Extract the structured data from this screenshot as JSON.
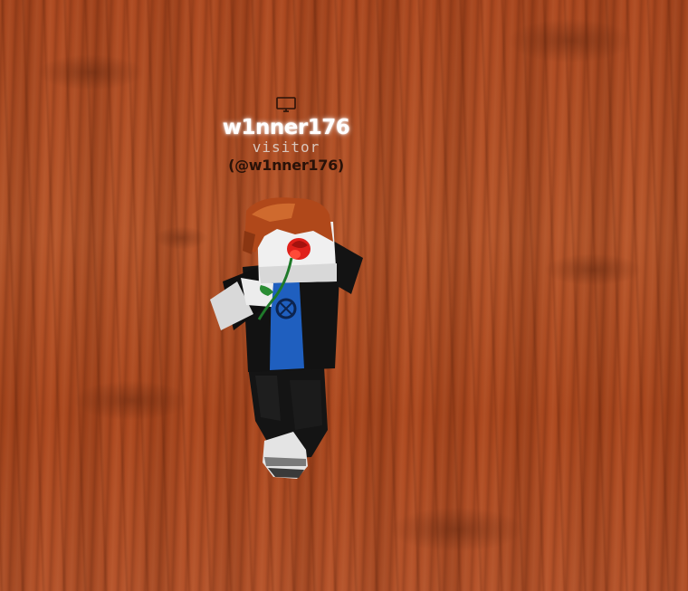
{
  "player": {
    "display_name": "w1nner176",
    "role": "visitor",
    "username": "(@w1nner176)",
    "device_icon": "monitor-icon"
  },
  "colors": {
    "floor": "#ab4a20",
    "name_text": "#ffffff",
    "role_text": "#d9c6bc",
    "username_text": "#2a1208",
    "shirt": "#1f5fbf",
    "jacket": "#121212",
    "hair": "#b0481a",
    "rose": "#e0201a"
  }
}
